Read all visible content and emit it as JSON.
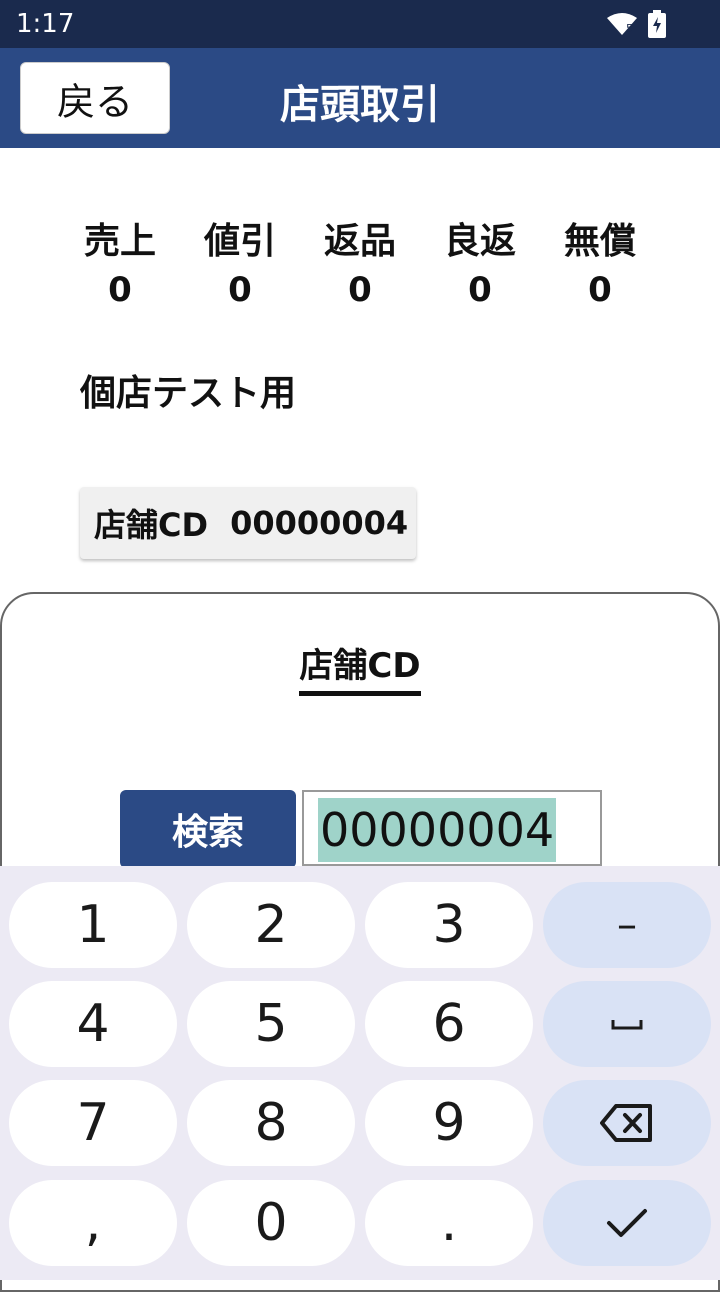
{
  "status_bar": {
    "time": "1:17",
    "signal_badge": "5"
  },
  "app_bar": {
    "back_label": "戻る",
    "title": "店頭取引"
  },
  "counters": [
    {
      "label": "売上",
      "value": "0"
    },
    {
      "label": "値引",
      "value": "0"
    },
    {
      "label": "返品",
      "value": "0"
    },
    {
      "label": "良返",
      "value": "0"
    },
    {
      "label": "無償",
      "value": "0"
    }
  ],
  "shop_name": "個店テスト用",
  "store_code": {
    "label": "店舗CD",
    "value": "00000004"
  },
  "sheet": {
    "title": "店舗CD",
    "search_label": "検索",
    "input_value": "00000004"
  },
  "keyboard": {
    "keys": [
      "1",
      "2",
      "3",
      "–",
      "4",
      "5",
      "6",
      "␣",
      "7",
      "8",
      "9",
      "⌫",
      ",",
      "0",
      ".",
      "✓"
    ]
  },
  "colors": {
    "appbar": "#2b4a85",
    "statusbar": "#1a2a4d",
    "selection": "#9fd3c9",
    "keyboard_bg": "#eceaf4",
    "fn_key": "#d9e2f5"
  }
}
